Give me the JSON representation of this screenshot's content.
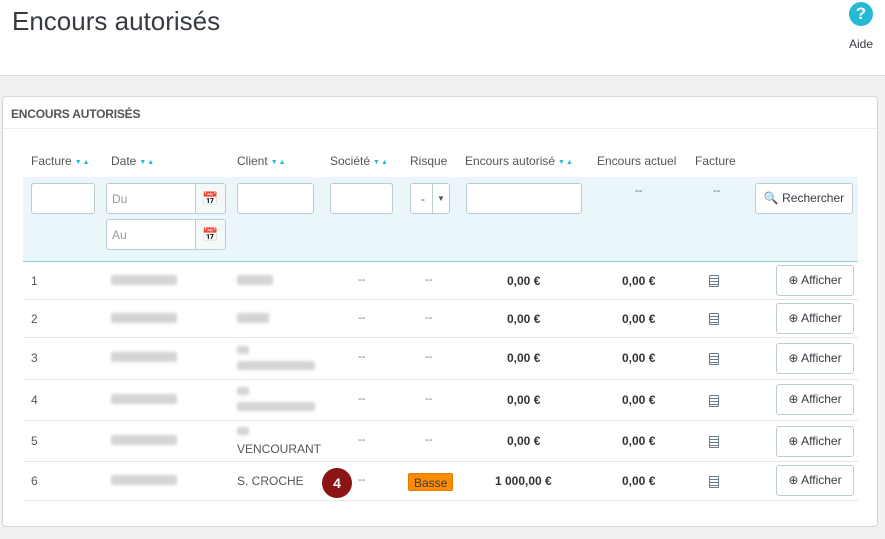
{
  "header": {
    "title": "Encours autorisés",
    "help_icon": "?",
    "help_label": "Aide"
  },
  "panel": {
    "heading": "ENCOURS AUTORISÉS",
    "columns": [
      {
        "label": "Facture",
        "sortable": true
      },
      {
        "label": "Date",
        "sortable": true
      },
      {
        "label": "Client",
        "sortable": true
      },
      {
        "label": "Société",
        "sortable": true
      },
      {
        "label": "Risque",
        "sortable": false
      },
      {
        "label": "Encours autorisé",
        "sortable": true
      },
      {
        "label": "Encours actuel",
        "sortable": false
      },
      {
        "label": "Facture",
        "sortable": false
      }
    ],
    "sort_glyph": "▼▲"
  },
  "filters": {
    "facture_value": "",
    "date_from_placeholder": "Du",
    "date_to_placeholder": "Au",
    "calendar_glyph": "📅",
    "client_value": "",
    "societe_value": "",
    "risque_selected": "-",
    "risque_caret": "▼",
    "encours_value": "",
    "encours_actuel": "--",
    "facture_dash": "--",
    "search_label": "Rechercher",
    "search_icon": "🔍"
  },
  "rows": [
    {
      "facture": "1",
      "client": "",
      "societe": "--",
      "risque": "--",
      "encours_autorise": "0,00 €",
      "encours_actuel": "0,00 €",
      "action": "Afficher"
    },
    {
      "facture": "2",
      "client": "",
      "societe": "--",
      "risque": "--",
      "encours_autorise": "0,00 €",
      "encours_actuel": "0,00 €",
      "action": "Afficher"
    },
    {
      "facture": "3",
      "client": "",
      "societe": "--",
      "risque": "--",
      "encours_autorise": "0,00 €",
      "encours_actuel": "0,00 €",
      "action": "Afficher"
    },
    {
      "facture": "4",
      "client": "",
      "societe": "--",
      "risque": "--",
      "encours_autorise": "0,00 €",
      "encours_actuel": "0,00 €",
      "action": "Afficher"
    },
    {
      "facture": "5",
      "client": "VENCOURANT",
      "societe": "--",
      "risque": "--",
      "encours_autorise": "0,00 €",
      "encours_actuel": "0,00 €",
      "action": "Afficher"
    },
    {
      "facture": "6",
      "client": "S. CROCHE",
      "societe": "--",
      "risque_badge": "Basse",
      "encours_autorise": "1 000,00 €",
      "encours_actuel": "0,00 €",
      "action": "Afficher"
    }
  ],
  "view_icon": "⊕",
  "marker": "4",
  "colors": {
    "accent": "#25b9d7",
    "badge": "#ff8c00",
    "marker": "#8b1414"
  }
}
